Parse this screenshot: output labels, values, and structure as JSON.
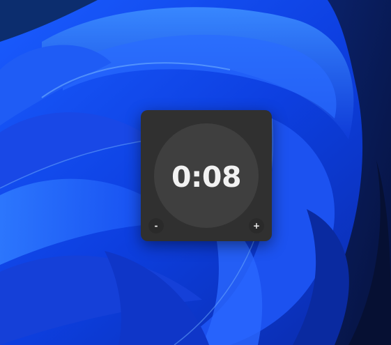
{
  "timer": {
    "time": "0:08",
    "decrement_label": "-",
    "increment_label": "+"
  },
  "colors": {
    "widget_bg": "#303030",
    "dial_bg": "#3f3f3f",
    "text": "#f2f2f2",
    "wallpaper_primary": "#1f4fff"
  }
}
